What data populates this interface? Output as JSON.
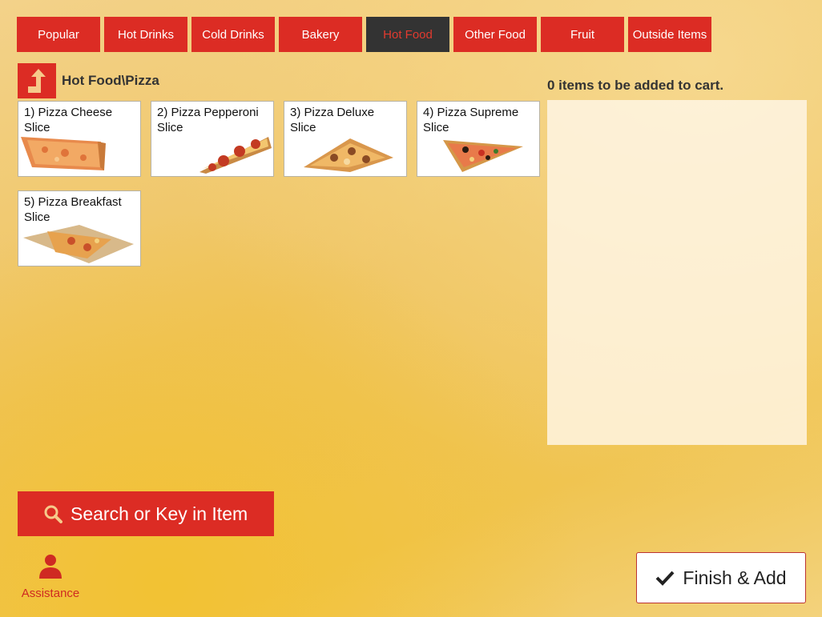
{
  "tabs": [
    {
      "label": "Popular",
      "active": false
    },
    {
      "label": "Hot Drinks",
      "active": false
    },
    {
      "label": "Cold Drinks",
      "active": false
    },
    {
      "label": "Bakery",
      "active": false
    },
    {
      "label": "Hot Food",
      "active": true
    },
    {
      "label": "Other Food",
      "active": false
    },
    {
      "label": "Fruit",
      "active": false
    },
    {
      "label": "Outside Items",
      "active": false
    }
  ],
  "breadcrumb": {
    "path": "Hot Food\\Pizza",
    "up_icon": "up-arrow-icon"
  },
  "items": [
    {
      "label": "1) Pizza Cheese Slice",
      "image": "cheese-pizza-slice-image"
    },
    {
      "label": "2) Pizza Pepperoni Slice",
      "image": "pepperoni-pizza-slice-image"
    },
    {
      "label": "3) Pizza Deluxe Slice",
      "image": "deluxe-pizza-slice-image"
    },
    {
      "label": "4) Pizza Supreme Slice",
      "image": "supreme-pizza-slice-image"
    },
    {
      "label": "5) Pizza Breakfast Slice",
      "image": "breakfast-pizza-slice-image"
    }
  ],
  "cart": {
    "title": "0 items to be added to cart."
  },
  "search": {
    "label": "Search or Key in Item",
    "icon": "search-icon"
  },
  "assistance": {
    "label": "Assistance",
    "icon": "person-icon"
  },
  "finish": {
    "label": "Finish & Add",
    "icon": "checkmark-icon"
  },
  "colors": {
    "accent": "#dc2c24",
    "active_tab_bg": "#333333",
    "background": "#efc35d"
  }
}
